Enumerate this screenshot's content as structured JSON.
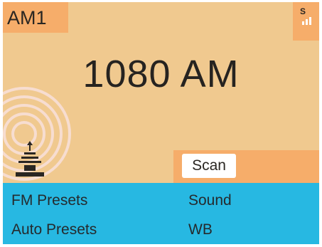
{
  "band": {
    "label": "AM1"
  },
  "signal": {
    "letter": "S",
    "icon": "signal-strength-icon"
  },
  "tuner": {
    "frequency": "1080 AM"
  },
  "controls": {
    "scan_label": "Scan"
  },
  "menu": {
    "fm_presets": "FM Presets",
    "sound": "Sound",
    "auto_presets": "Auto Presets",
    "wb": "WB"
  },
  "decor": {
    "antenna_icon": "radio-tower-icon"
  },
  "colors": {
    "background": "#f0c98f",
    "accent": "#f6ad6a",
    "menu_bar": "#27b8e2",
    "text": "#262320"
  }
}
